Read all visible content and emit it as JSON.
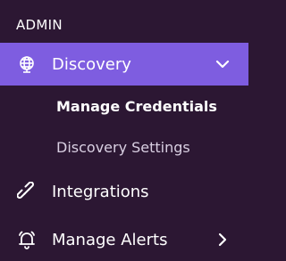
{
  "sidebar": {
    "section_title": "ADMIN",
    "items": [
      {
        "label": "Discovery",
        "icon": "globe-icon",
        "active": true,
        "expanded": true,
        "chevron": "chevron-down-icon"
      },
      {
        "label": "Integrations",
        "icon": "link-icon"
      },
      {
        "label": "Manage Alerts",
        "icon": "bell-icon",
        "chevron": "chevron-right-icon"
      }
    ],
    "discovery_subitems": [
      {
        "label": "Manage Credentials",
        "current": true
      },
      {
        "label": "Discovery Settings"
      }
    ]
  },
  "colors": {
    "background": "#2c1733",
    "active_background": "#7e5de0",
    "text": "#ffffff",
    "subtext": "#d9cfe2"
  }
}
